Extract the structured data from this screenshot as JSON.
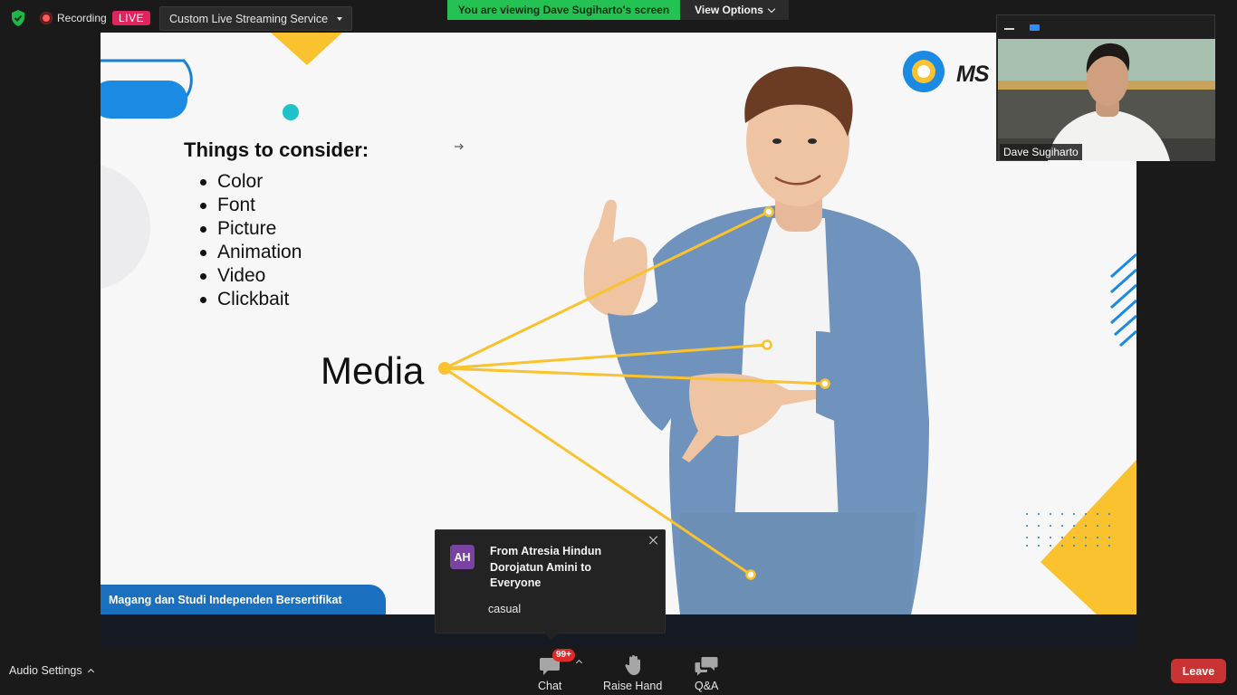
{
  "topbar": {
    "recording_label": "Recording",
    "live_label": "LIVE",
    "stream_service": "Custom Live Streaming Service",
    "viewing_banner": "You are viewing Dave Sugiharto's screen",
    "view_options": "View Options"
  },
  "slide": {
    "heading": "Things to consider:",
    "bullets": [
      "Color",
      "Font",
      "Picture",
      "Animation",
      "Video",
      "Clickbait"
    ],
    "media_label": "Media",
    "footer": "Magang dan Studi Independen Bersertifikat",
    "logo_text": "MS",
    "colors": {
      "accent_yellow": "#f9c22e",
      "accent_blue": "#1a6fbf",
      "accent_teal": "#1ec3c9"
    }
  },
  "self_view": {
    "name": "Dave Sugiharto"
  },
  "chat_popup": {
    "avatar_initials": "AH",
    "from_text": "From Atresia Hindun Dorojatun Amini to Everyone",
    "message": "casual"
  },
  "toolbar": {
    "audio_settings": "Audio Settings",
    "chat_label": "Chat",
    "chat_badge": "99+",
    "raise_hand_label": "Raise Hand",
    "qa_label": "Q&A",
    "leave_label": "Leave"
  }
}
